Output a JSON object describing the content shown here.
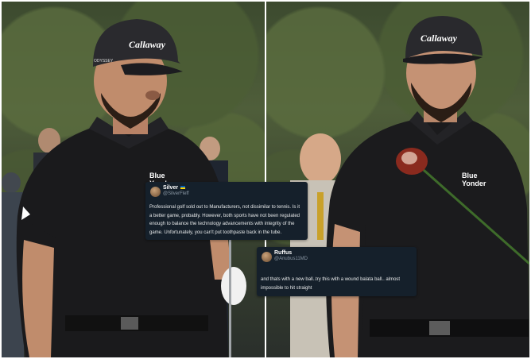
{
  "left_photo": {
    "cap_brand": "Callaway",
    "cap_side": "ODYSSEY",
    "shirt_logo": "Blue Yonder"
  },
  "right_photo": {
    "cap_brand": "Callaway",
    "shirt_logo": "Blue Yonder"
  },
  "tweets": [
    {
      "name": "Silver",
      "handle": "@SilverFleff",
      "text": "Professional golf sold out to Manufacturers, not dissimilar to tennis. Is it a better game, probably. However, both sports have not been regulated enough to balance the technology advancements with integrity of the game. Unfortunately, you can't put toothpaste back in the tube."
    },
    {
      "name": "Ruffus",
      "handle": "@Anubus11MD",
      "text": "and thats with a new ball..try this with a wound balata ball.. almost impossible to hit straight"
    }
  ]
}
